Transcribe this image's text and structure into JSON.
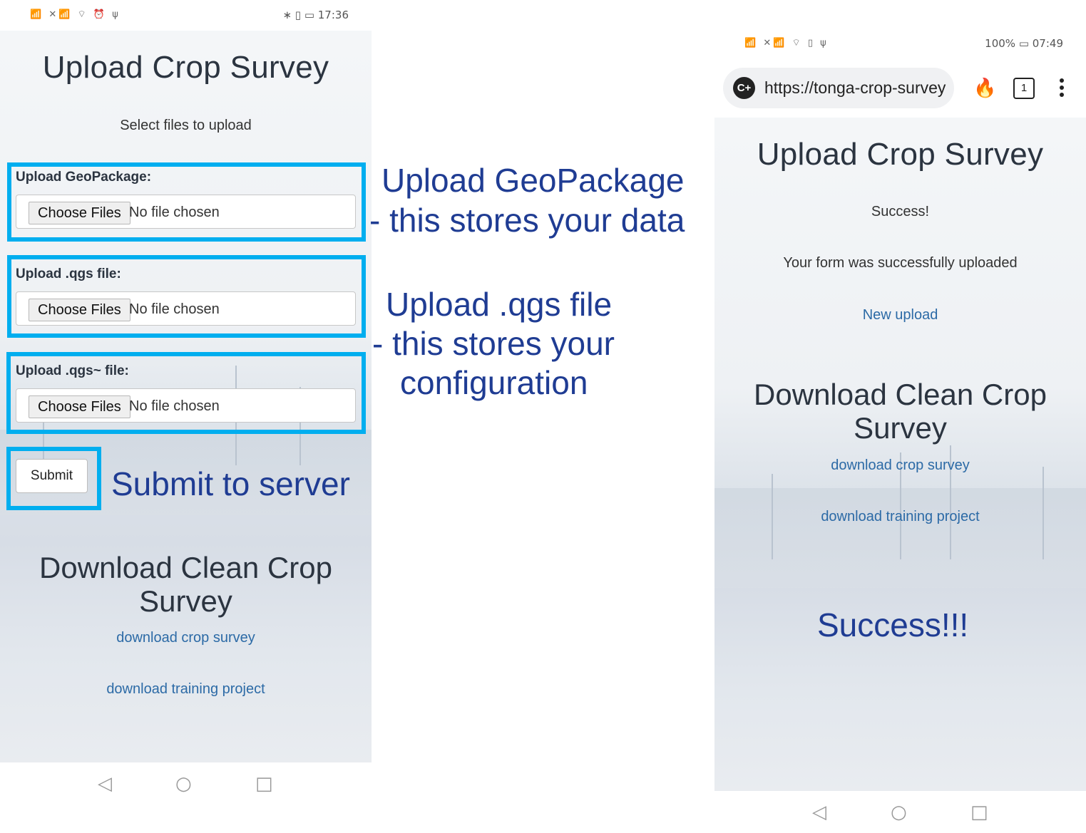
{
  "left_screen": {
    "status": {
      "icons": "📶 ✕📶 ⌔ ⏰ ψ",
      "right": "∗ ▯ ▭ 17:36"
    },
    "title": "Upload Crop Survey",
    "subtitle": "Select files to upload",
    "fields": [
      {
        "label": "Upload GeoPackage:",
        "button": "Choose Files",
        "status": "No file chosen"
      },
      {
        "label": "Upload .qgs file:",
        "button": "Choose Files",
        "status": "No file chosen"
      },
      {
        "label": "Upload .qgs~ file:",
        "button": "Choose Files",
        "status": "No file chosen"
      }
    ],
    "submit_label": "Submit",
    "download_heading_line1": "Download Clean Crop",
    "download_heading_line2": "Survey",
    "links": [
      "download crop survey",
      "download training project"
    ]
  },
  "annotations": {
    "geopackage_line1": "Upload GeoPackage",
    "geopackage_line2": "- this stores your data",
    "qgs_line1": "Upload .qgs file",
    "qgs_line2": "- this stores your",
    "qgs_line3": "configuration",
    "submit": "Submit to server",
    "success": "Success!!!"
  },
  "right_screen": {
    "status": {
      "icons": "📶 ✕📶 ⌔ ▯ ψ",
      "right": "100% ▭ 07:49"
    },
    "url": "https://tonga-crop-survey",
    "url_badge": "C+",
    "tab_count": "1",
    "title": "Upload Crop Survey",
    "success": "Success!",
    "message": "Your form was successfully uploaded",
    "new_upload": "New upload",
    "download_heading_line1": "Download Clean Crop",
    "download_heading_line2": "Survey",
    "links": [
      "download crop survey",
      "download training project"
    ]
  },
  "nav_icons": [
    "back-triangle-icon",
    "home-circle-icon",
    "recents-square-icon"
  ],
  "colors": {
    "highlight": "#00aeef",
    "annotation": "#1f3c93",
    "link": "#2c6aa6",
    "heading": "#2b3440"
  }
}
